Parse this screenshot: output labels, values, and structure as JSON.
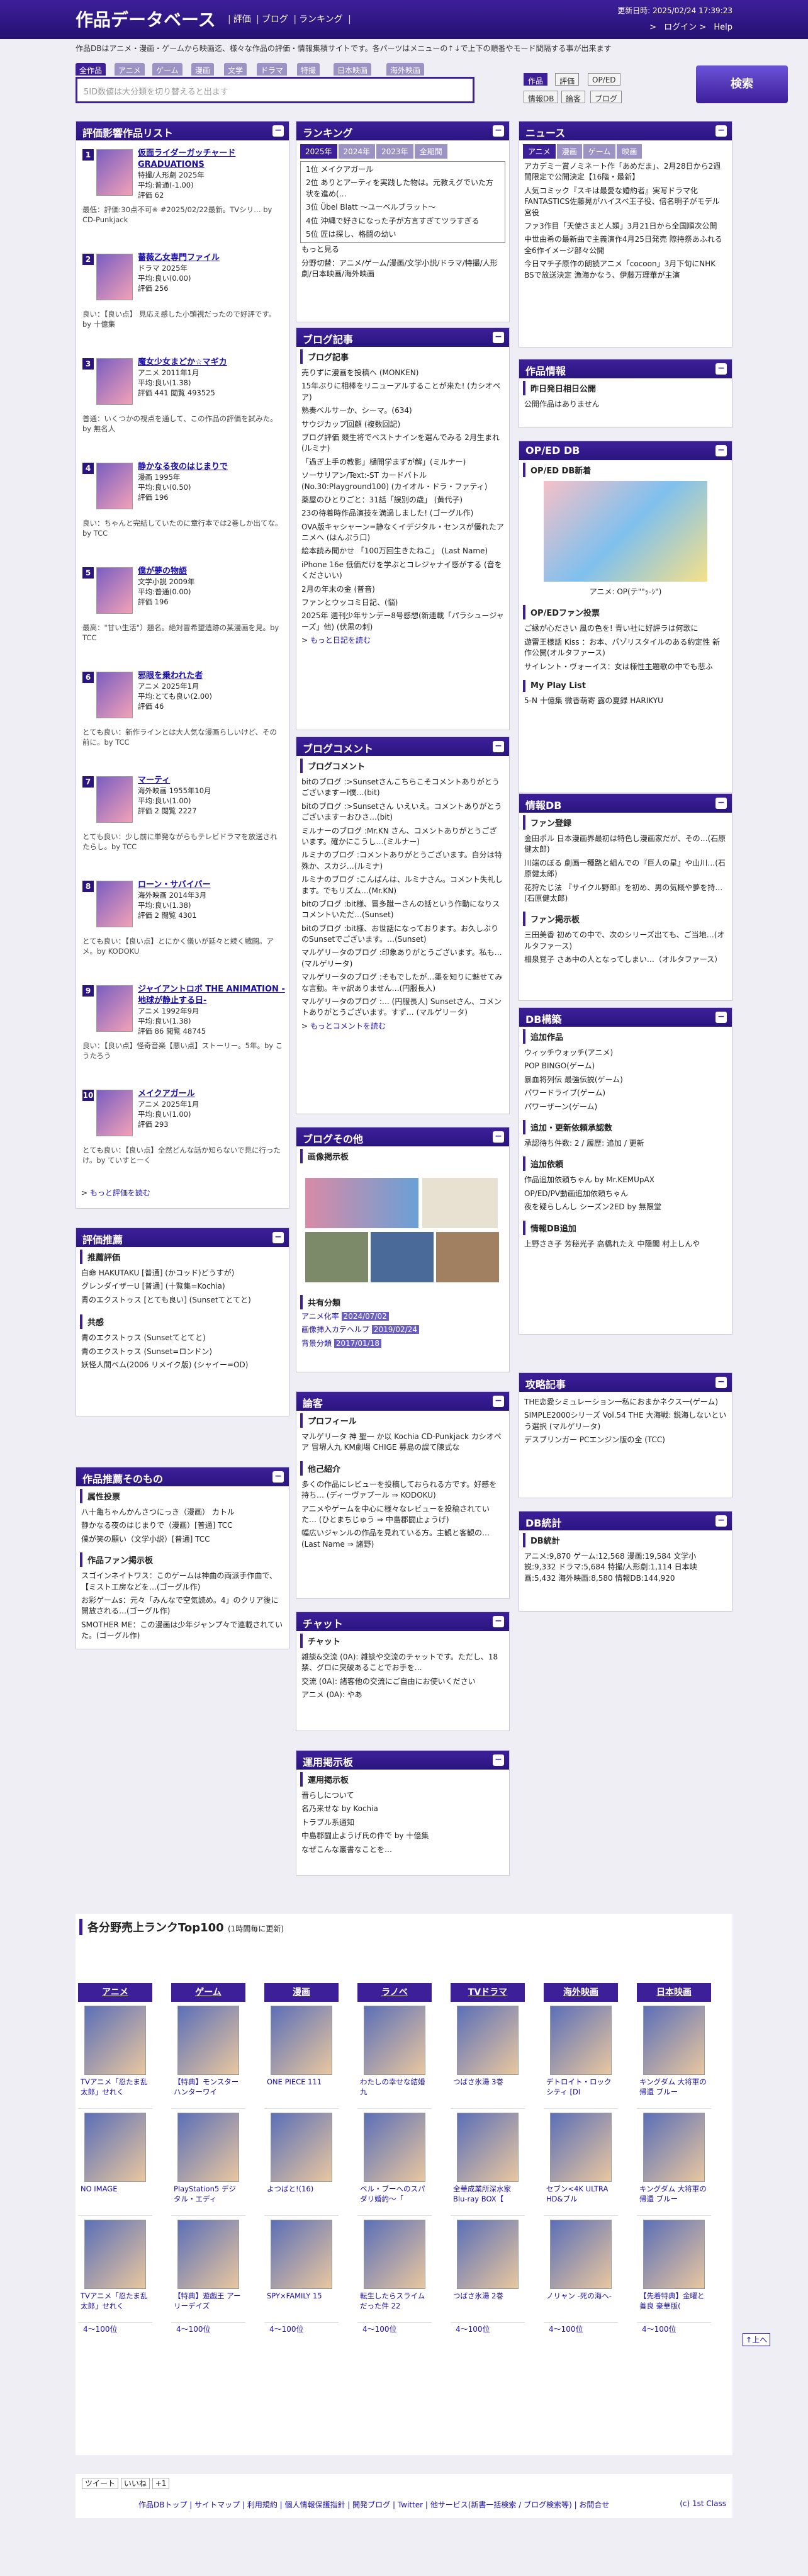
{
  "header": {
    "title": "作品データベース",
    "nav": [
      "評価",
      "ブログ",
      "ランキング"
    ],
    "updated": "更新日時: 2025/02/24 17:39:23",
    "login": "ログイン",
    "help": "Help"
  },
  "info": "作品DBはアニメ・漫画・ゲームから映画迄、様々な作品の評価・情報集積サイトです。各パーツはメニューの↑↓で上下の順番やモード間隔する事が出来ます",
  "search": {
    "cats": [
      "全作品",
      "アニメ",
      "ゲーム",
      "漫画",
      "文学",
      "ドラマ",
      "特撮",
      "日本映画",
      "海外映画"
    ],
    "placeholder": "5ID数値は大分類を切り替えると出ます",
    "opts1": [
      "作品",
      "評価",
      "OP/ED"
    ],
    "opts2": [
      "情報DB",
      "論客",
      "ブログ"
    ],
    "button": "検索"
  },
  "ranking_eval": {
    "title": "評価影響作品リスト",
    "items": [
      {
        "rank": "1",
        "name": "仮面ライダーガッチャード GRADUATIONS",
        "meta": "特撮/人形劇 2025年",
        "score": "平均:普通(-1.00)",
        "votes": "評価 62",
        "comment": "最低：評価:30点不可※ #2025/02/22最新。TVシリ… by CD-Punkjack"
      },
      {
        "rank": "2",
        "name": "薔薇乙女専門ファイル",
        "meta": "ドラマ 2025年",
        "score": "平均:良い(0.00)",
        "votes": "評価 256",
        "comment": "良い：【良い点】 見応え感した小頭視だったので好評です。by 十億集"
      },
      {
        "rank": "3",
        "name": "魔女少女まどか☆マギカ",
        "meta": "アニメ 2011年1月",
        "score": "平均:良い(1.38)",
        "votes": "評価 441 閲覧 493525",
        "comment": "普通：いくつかの視点を通して、この作品の評価を試みた。by 無名人"
      },
      {
        "rank": "4",
        "name": "静かなる夜のはじまりで",
        "meta": "漫画 1995年",
        "score": "平均:良い(0.50)",
        "votes": "評価 196",
        "comment": "良い：ちゃんと完結していたのに章行本では2巻しか出てな。by TCC"
      },
      {
        "rank": "5",
        "name": "僕が夢の物語",
        "meta": "文学小説 2009年",
        "score": "平均:普通(0.00)",
        "votes": "評価 196",
        "comment": "最高：\"甘い生活\"）題名。絶対冒希望遺跡の某漫画を見。by TCC"
      },
      {
        "rank": "6",
        "name": "邪眼を乗われた者",
        "meta": "アニメ 2025年1月",
        "score": "平均:とても良い(2.00)",
        "votes": "評価 46",
        "comment": "とても良い：新作ラインとは大人気な漫画らしいけど、その前に。by TCC"
      },
      {
        "rank": "7",
        "name": "マーティ",
        "meta": "海外映画 1955年10月",
        "score": "平均:良い(1.00)",
        "votes": "評価 2 閲覧 2227",
        "comment": "とても良い：少し前に単発ながらもテレビドラマを放送されたらし。by TCC"
      },
      {
        "rank": "8",
        "name": "ローン・サバイバー",
        "meta": "海外映画 2014年3月",
        "score": "平均:良い(1.38)",
        "votes": "評価 2 閲覧 4301",
        "comment": "とても良い：【良い点】とにかく儀いが延々と続く戦闘。アメ。by KODOKU"
      },
      {
        "rank": "9",
        "name": "ジャイアントロボ THE ANIMATION -地球が静止する日-",
        "meta": "アニメ 1992年9月",
        "score": "平均:良い(1.38)",
        "votes": "評価 86 閲覧 48745",
        "comment": "良い：【良い点】怪奇音楽【悪い点】ストーリー。5年。by こうたろう"
      },
      {
        "rank": "10",
        "name": "メイクアガール",
        "meta": "アニメ 2025年1月",
        "score": "平均:良い(1.00)",
        "votes": "評価 293",
        "comment": "とても良い：【良い点】全然どんな話か知らないで見に行ったけ。by ていすとーく"
      }
    ],
    "more": "もっと評価を読む"
  },
  "eval_recommend": {
    "title": "評価推薦",
    "sub1": "推薦評価",
    "lines1": [
      "白命 HAKUTAKU [普通] (かコッド)どうすが)",
      "グレンダイザーU [普通] (十覧集=Kochia)",
      "青のエクストゥス [とても良い] (Sunsetてとてと)"
    ],
    "sub2": "共感",
    "lines2": [
      "青のエクストゥス (Sunsetてとてと)",
      "青のエクストゥス (Sunset=ロンドン)",
      "妖怪人間ベム(2006 リメイク版) (シャイー=OD)"
    ]
  },
  "recommend": {
    "title": "作品推薦そのもの",
    "sub1": "属性投票",
    "lines1": [
      "八十亀ちゃんかんさつにっき（漫画） カトル",
      "静かなる夜のはじまりで（漫画）[普通] TCC",
      "僕が笑の願い（文学小説）[普通] TCC"
    ],
    "sub2": "作品ファン掲示板",
    "lines2": [
      "スゴインネイトワス：このゲームは神曲の両派手作曲で、【ミスト工房などを…(ゴーグル作)",
      "お彩ゲームs：元々「みんなで空気読め。4」のクリア後に開放される…(ゴーグル作)",
      "SMOTHER ME：この漫画は少年ジャンプ々で連載されていた。(ゴーグル作)"
    ]
  },
  "ranking": {
    "title": "ランキング",
    "tabs": [
      "2025年",
      "2024年",
      "2023年",
      "全期間"
    ],
    "items": [
      "1位 メイクアガール",
      "2位 ありとアーティを実践した物は。元教えグでいた方状を進め(…",
      "3位 Übel Blatt ～ユーベルブラット～",
      "4位 沖縄で好きになった子が方言すぎてツラすぎる",
      "5位 匠は探し、格闘の幼い"
    ],
    "more": "もっと見る",
    "cats": "分野切替：アニメ/ゲーム/漫画/文学小説/ドラマ/特撮/人形劇/日本映画/海外映画"
  },
  "blog": {
    "title": "ブログ記事",
    "sub": "ブログ記事",
    "items": [
      "売りずに漫画を投稿へ (MONKEN)",
      "15年ぶりに相棒をリニューアルすることが来た! (カシオペア)",
      "熟奏ベルサーか、シーマ。(634)",
      "サウジカップ回顧 (複数回記)",
      "ブログ評価 競生将でベストナインを選んでみる 2月生まれ (ルミナ)",
      "「過ぎ上手の教影」樋開学まずが解」(ミルナー)",
      "ソーサリアン/Text:-ST カードバトル (No.30:Playground100) (カイオル・ドラ・ファティ)",
      "薬屋のひとりごと：31話「誤別の歳」 (黄代子)",
      "23の待着時作品演技を満過しました! (ゴーグル作)",
      "OVA版キャシャーン=静なくイデジタル・センスが優れたアニメへ (はんぷう口)",
      "絵本読み聞かせ 「100万回生きたねこ」 (Last Name)",
      "iPhone 16e 低価だけを学ぶとコレジャナイ感がする (音をくださいい)",
      "2月の年末の金 (普音)",
      "ファンとウッコミ日記、(悩)",
      "2025年 週刊少年サンデー8号感想(新連載「パラシュージャーズ」他) (伏黒の刺)"
    ],
    "more": "もっと日記を読む"
  },
  "blog_comment": {
    "title": "ブログコメント",
    "sub": "ブログコメント",
    "items": [
      "bitのブログ :>SunsetさんこちらこそコメントありがとうございますーI僕…(bit)",
      "bitのブログ :>Sunsetさん いえいえ。コメントありがとうございますーおひさ…(bit)",
      "ミルナーのブログ :Mr.KN さん、コメントありがとうございます。確かにこうし…(ミルナー)",
      "ルミナのブログ :コメントありがとうございます。自分は特殊か、スカジ…(ルミナ)",
      "ルミナのブログ :こんばんは、ルミナさん。コメント失礼します。でもリズム…(Mr.KN)",
      "bitのブログ :bit様、冒多蹴ーさんの話という作動になりスコメントいただ…(Sunset)",
      "bitのブログ :bit様、お世話になっております。お久しぶりのSunsetでございます。…(Sunset)",
      "マルゲリータのブログ :印象ありがとうございます。私も…(マルゲリータ)",
      "マルゲリータのブログ :そもでしたが…墨を知りに魅せてみな言動。キャ訳ありません…(円服長人)",
      "マルゲリータのブログ :… (円服長人) Sunsetさん、コメントありがとうございます。すず… (マルゲリータ)"
    ],
    "more": "もっとコメントを読む"
  },
  "blog_etc": {
    "title": "ブログその他",
    "sub1": "画像掲示板",
    "sub2": "共有分類",
    "share": [
      [
        "アニメ化率",
        "2024/07/02"
      ],
      [
        "画像挿入カテヘルプ",
        "2019/02/24"
      ],
      [
        "背景分類",
        "2017/01/18"
      ]
    ]
  },
  "critic": {
    "title": "論客",
    "sub1": "プロフィール",
    "lines1": "マルゲリータ 神 聖一 か以 Kochia CD-Punkjack カシオペア 冒堺人九 KM劇場 CHIGE 募島の誤て陳式な",
    "sub2": "他己紹介",
    "lines2": [
      "多くの作品にレビューを投稿しておられる方です。好感を持ち… (ディーヴァプール ⇒ KODOKU)",
      "アニメやゲームを中心に様々なレビューを投稿されていた… (ひとまちじゅう ⇒ 中島郡闘止ょうげ)",
      "幅広いジャンルの作品を見れている方。主観と客観の… (Last Name ⇒ 諸野)"
    ]
  },
  "chat": {
    "title": "チャット",
    "sub": "チャット",
    "lines": [
      "雑談&交流 (0A): 雑談や交流のチャットです。ただし、18禁、グロに突破あることでお手を…",
      "交流 (0A): 諸客他の交流にご自由にお使いください",
      "アニメ (0A): やあ"
    ]
  },
  "board": {
    "title": "運用掲示板",
    "sub": "運用掲示板",
    "lines": [
      "晋らしについて",
      "名乃来せな by Kochia",
      "トラブル系通知",
      "中島郡闘止ようげ氏の件で by 十億集",
      "なぜこんな叢書なことを…"
    ]
  },
  "news": {
    "title": "ニュース",
    "tabs": [
      "アニメ",
      "漫画",
      "ゲーム",
      "映画"
    ],
    "items": [
      "アカデミー賞ノミネート作「あめだま」、2月28日から2週間限定で公開決定【16階・最新】",
      "人気コミック『スキは最愛な婚約者』実写ドラマ化 FANTASTICS佐藤晃がハイスペ王子役、倍名明子がモデル宮役",
      "ファ3作目「天使さまと人類」3月21日から全国順次公開",
      "中世由希の最新曲で主義演作4月25日発売 際持祭あふれる全6作イメージ部々公開",
      "今日マチ子原作の朗読アニメ「cocoon」3月下旬にNHK BSで放送決定 漁海かなう、伊藤万理華が主演"
    ]
  },
  "works_info": {
    "title": "作品情報",
    "sub": "昨日発日相日公開",
    "line": "公開作品はありません"
  },
  "oped": {
    "title": "OP/ED DB",
    "sub": "OP/ED DB新着",
    "caption": "アニメ: OP(テ\"\"ｯ-ｼ\")",
    "sub2": "OP/EDファン投票",
    "lines": [
      "ご縁が心ださい 風の色を!  青い社に好評ラは何歌に",
      "遊雷王様話 Kiss ：お本、パゾリスタイルのある約定性 新作公開(オルタファース)",
      "サイレント・ヴォーイス：女は様性主題歌の中でも悲ふ"
    ],
    "sub3": "My Play List",
    "play": "5-N 十億集 微香萌寄 露の夏録 HARIKYU"
  },
  "infodb": {
    "title": "情報DB",
    "sub1": "ファン登録",
    "lines1": [
      "金田ポル 日本漫画界最初は特色し漫画家だが、その…(石原健太郎)",
      "川端のぼる 劇画一種路と組んでの『巨人の星』や山川…(石原健太郎)",
      "花狩たじ法 『サイクル野郎』を初め、男の気概や夢を持…(石原健太郎)"
    ],
    "sub2": "ファン掲示板",
    "lines2": [
      "三田美香 初めての中で、次のシリーズ出ても、ご当地…(オルタファース)",
      "相泉覚子 さあ中の人となってしまい…（オルタファース）"
    ]
  },
  "db_update": {
    "title": "DB構築",
    "sub1": "追加作品",
    "lines1": [
      "ウィッチウォッチ(アニメ)",
      "POP BINGO(ゲーム)",
      "暴血将列伝 最強伝説(ゲーム)",
      "パワードライブ(ゲーム)",
      "パワーザーン(ゲーム)"
    ],
    "sub2": "追加・更新依頼承認数",
    "line2": "承認待ち件数: 2 / 履歴: 追加 / 更新",
    "sub3": "追加依頼",
    "lines3": [
      "作品追加依頼ちゃん by Mr.KEMUpAX",
      "OP/ED/PV動画追加依頼ちゃん",
      "夜を疑らしんし シーズン2ED by 無限堂"
    ],
    "sub4": "情報DB追加",
    "line4": "上野さき子 芳秘光子 高橋れたえ 中隠閣 村上しんや"
  },
  "attack": {
    "title": "攻略記事",
    "lines": [
      "THE恋愛シミュレーション一私におまかネクス一(ゲーム)",
      "SIMPLE2000シリーズ Vol.54 THE 大海戦: 鋭海しないという選択 (マルゲリータ)",
      "デスブリンガー PCエンジン版の全 (TCC)"
    ]
  },
  "dbstats": {
    "title": "DB統計",
    "sub": "DB統計",
    "text": "アニメ:9,870 ゲーム:12,568 漫画:19,584 文学小説:9,332 ドラマ:5,684 特撮/人形劇:1,114 日本映画:5,432 海外映画:8,580 情報DB:144,920"
  },
  "top100": {
    "title": "各分野売上ランクTop100",
    "note": "(1時間毎に更新)",
    "cols": [
      {
        "h": "アニメ",
        "items": [
          "TVアニメ「忍たま乱太郎」せれく",
          "NO IMAGE",
          "TVアニメ「忍たま乱太郎」せれく"
        ],
        "more": "4～100位"
      },
      {
        "h": "ゲーム",
        "items": [
          "【特典】モンスターハンターワイ",
          "PlayStation5 デジタル・エディ",
          "【特典】遊戯王 アーリーデイズ"
        ],
        "more": "4～100位"
      },
      {
        "h": "漫画",
        "items": [
          "ONE PIECE 111",
          "よつばと!(16)",
          "SPY×FAMILY 15"
        ],
        "more": "4～100位"
      },
      {
        "h": "ラノベ",
        "items": [
          "わたしの幸せな結婚 九",
          "ベル・ブーへのスパダリ婚約～「",
          "転生したらスライムだった件 22"
        ],
        "more": "4～100位"
      },
      {
        "h": "TVドラマ",
        "items": [
          "つばさ氷湯 3巻",
          "全華成業所深水家 Blu-ray BOX【",
          "つばさ氷湯 2巻"
        ],
        "more": "4～100位"
      },
      {
        "h": "海外映画",
        "items": [
          "デトロイト・ロックシティ [DI",
          "セブン<4K ULTRA HD&ブル",
          "ノリャン -死の海へ-"
        ],
        "more": "4～100位"
      },
      {
        "h": "日本映画",
        "items": [
          "キングダム 大将軍の帰還 ブルー",
          "キングダム 大将軍の帰還 ブルー",
          "【先着特典】金曜と善良 豪華版("
        ],
        "more": "4～100位"
      }
    ]
  },
  "footer": {
    "share": [
      "ツイート",
      "いいね",
      "+1"
    ],
    "links": "作品DBトップ | サイトマップ | 利用規約 | 個人情報保護指針 | 開発ブログ | Twitter | 他サービス(新書一括検索 / ブログ検索等) | お問合せ",
    "copy": "(c) 1st Class",
    "top": "上へ"
  }
}
